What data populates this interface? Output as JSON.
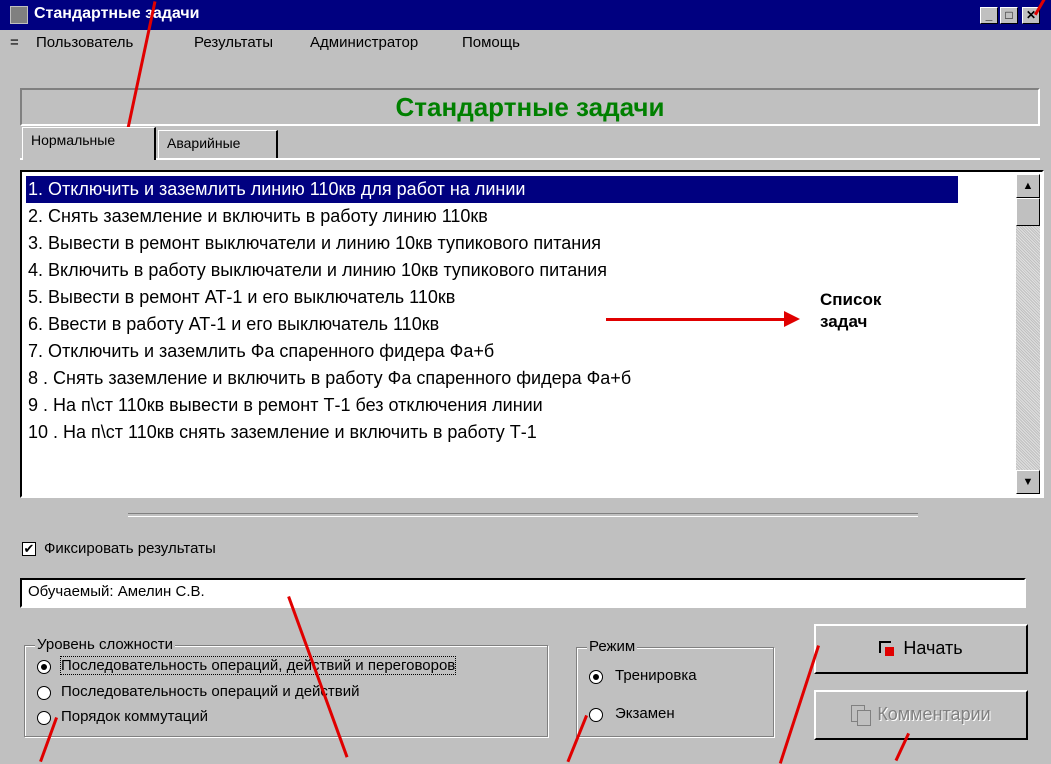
{
  "window": {
    "title": "Стандартные задачи",
    "controls": {
      "minimize": "_",
      "maximize": "□",
      "close": "✕"
    }
  },
  "menu": {
    "system": "=",
    "items": [
      "Пользователь",
      "Результаты",
      "Администратор",
      "Помощь"
    ]
  },
  "banner": {
    "title": "Стандартные задачи",
    "color": "#008000"
  },
  "tabs": [
    {
      "label": "Нормальные",
      "active": true
    },
    {
      "label": "Аварийные",
      "active": false
    }
  ],
  "task_list": {
    "selected_index": 0,
    "items": [
      "1. Отключить и заземлить линию 110кв для работ на линии",
      "2.  Снять заземление и включить в работу линию 110кв",
      "3.  Вывести в ремонт выключатели и линию 10кв тупикового питания",
      "4.   Включить в работу выключатели и линию 10кв тупикового питания",
      "5.   Вывести в ремонт АТ-1 и его выключатель 110кв",
      "6.   Ввести в работу АТ-1 и его выключатель 110кв",
      "7.   Отключить и заземлить Фа спаренного фидера Фа+б",
      "8 . Снять заземление  и включить в работу Фа спаренного фидера  Фа+б",
      "9 .  На п\\ст 110кв вывести в ремонт Т-1 без отключения линии",
      "10 . На  п\\ст 110кв снять заземление и включить в работу Т-1"
    ]
  },
  "annotation": {
    "line1": "Список",
    "line2": "задач",
    "color": "#e00000"
  },
  "fix_results": {
    "label": "Фиксировать результаты",
    "checked": true,
    "mark": "✔"
  },
  "trainee": {
    "value": "Обучаемый: Амелин С.В."
  },
  "difficulty": {
    "legend": "Уровень сложности",
    "options": [
      {
        "label": "Последовательность операций, действий и переговоров",
        "selected": true
      },
      {
        "label": "Последовательность операций и действий",
        "selected": false
      },
      {
        "label": "Порядок коммутаций",
        "selected": false
      }
    ]
  },
  "mode": {
    "legend": "Режим",
    "options": [
      {
        "label": "Тренировка",
        "selected": true
      },
      {
        "label": "Экзамен",
        "selected": false
      }
    ]
  },
  "buttons": {
    "start": "Начать",
    "comments": "Комментарии"
  },
  "scrollbar": {
    "up": "▲",
    "down": "▼"
  }
}
